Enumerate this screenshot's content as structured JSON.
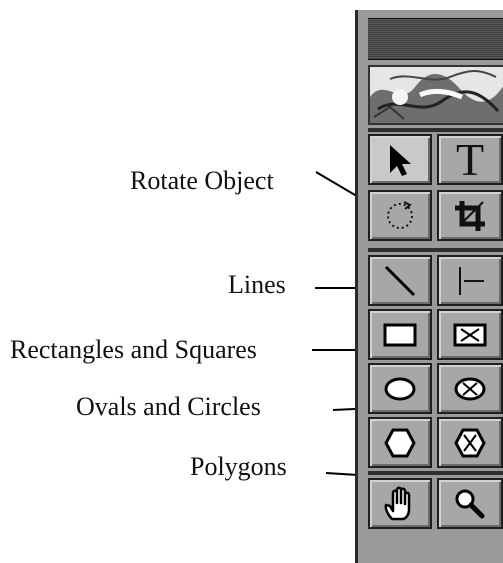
{
  "callouts": {
    "rotate_object": "Rotate Object",
    "lines": "Lines",
    "rectangles_and_squares": "Rectangles and Squares",
    "ovals_and_circles": "Ovals and Circles",
    "polygons": "Polygons"
  },
  "tools": {
    "text_glyph": "T"
  },
  "colors": {
    "palette_bg": "#9a9a9a",
    "button_bg": "#a7a7a7",
    "selected_button_bg": "#c9c9c9",
    "border_dark": "#1f1f1f"
  }
}
